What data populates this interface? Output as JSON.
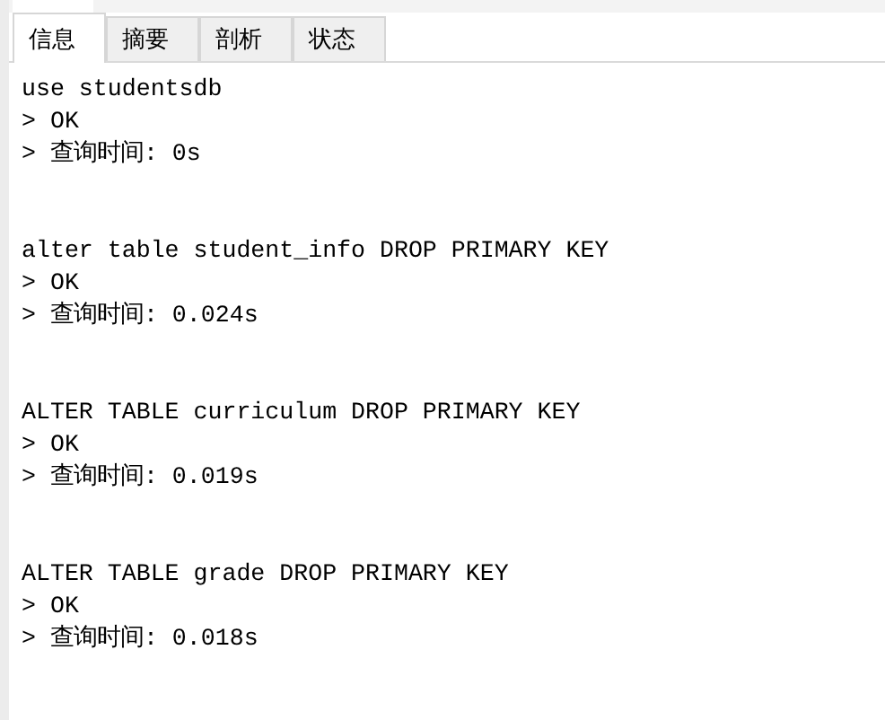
{
  "tabs": [
    {
      "label": "信息",
      "selected": true
    },
    {
      "label": "摘要",
      "selected": false
    },
    {
      "label": "剖析",
      "selected": false
    },
    {
      "label": "状态",
      "selected": false
    }
  ],
  "log": [
    {
      "statement": "use studentsdb",
      "result": "> OK",
      "time": "> 查询时间: 0s"
    },
    {
      "statement": "alter table student_info DROP PRIMARY KEY",
      "result": "> OK",
      "time": "> 查询时间: 0.024s"
    },
    {
      "statement": "ALTER TABLE curriculum DROP PRIMARY KEY",
      "result": "> OK",
      "time": "> 查询时间: 0.019s"
    },
    {
      "statement": "ALTER TABLE grade DROP PRIMARY KEY",
      "result": "> OK",
      "time": "> 查询时间: 0.018s"
    }
  ]
}
